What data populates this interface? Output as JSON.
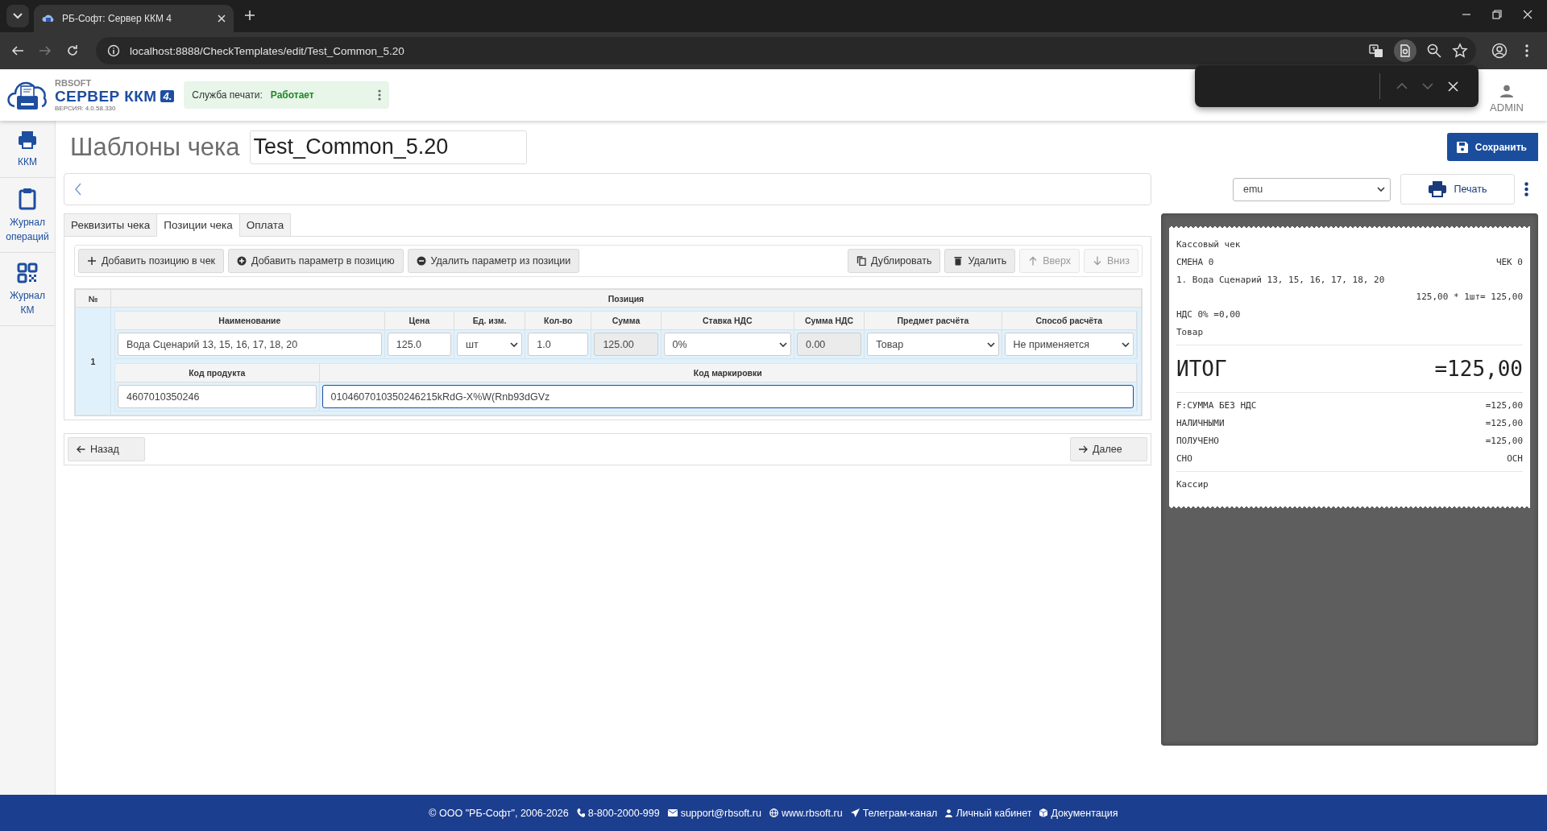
{
  "browser": {
    "tab_title": "РБ-Софт: Сервер ККМ 4",
    "url": "localhost:8888/CheckTemplates/edit/Test_Common_5.20"
  },
  "header": {
    "brand": "RBSOFT",
    "product": "СЕРВЕР ККМ",
    "product_badge": "4.",
    "version": "ВЕРСИЯ: 4.0.58.330",
    "print_service": {
      "label": "Служба печати:",
      "status": "Работает"
    },
    "user": "ADMIN"
  },
  "sidebar": {
    "items": [
      {
        "label": "ККМ"
      },
      {
        "label": "Журнал операций"
      },
      {
        "label": "Журнал КМ"
      }
    ]
  },
  "page": {
    "title": "Шаблоны чека",
    "template_name": "Test_Common_5.20",
    "save_button": "Сохранить",
    "printer": "emu",
    "print_button": "Печать"
  },
  "tabs": [
    {
      "label": "Реквизиты чека",
      "selected": false
    },
    {
      "label": "Позиции чека",
      "selected": true
    },
    {
      "label": "Оплата",
      "selected": false
    }
  ],
  "toolbar": {
    "left": [
      {
        "label": "Добавить позицию в чек",
        "disabled": false
      },
      {
        "label": "Добавить параметр в позицию",
        "disabled": false
      },
      {
        "label": "Удалить параметр из позиции",
        "disabled": false
      }
    ],
    "right": [
      {
        "label": "Дублировать",
        "disabled": false
      },
      {
        "label": "Удалить",
        "disabled": false
      },
      {
        "label": "Вверх",
        "disabled": true
      },
      {
        "label": "Вниз",
        "disabled": true
      }
    ]
  },
  "table": {
    "columns": [
      "№",
      "Позиция"
    ],
    "rows": [
      {
        "number": "1",
        "field_rows": [
          [
            {
              "label": "Наименование",
              "value": "Вода Сценарий 13, 15, 16, 17, 18, 20",
              "kind": "input",
              "focused": false
            },
            {
              "label": "Цена",
              "value": "125.0",
              "kind": "input",
              "focused": false
            },
            {
              "label": "Ед. изм.",
              "value": "шт",
              "kind": "select",
              "focused": false
            },
            {
              "label": "Кол-во",
              "value": "1.0",
              "kind": "input",
              "focused": false
            },
            {
              "label": "Сумма",
              "value": "125.00",
              "kind": "readonly",
              "focused": false
            },
            {
              "label": "Ставка НДС",
              "value": "0%",
              "kind": "select",
              "focused": false
            },
            {
              "label": "Сумма НДС",
              "value": "0.00",
              "kind": "readonly",
              "focused": false
            },
            {
              "label": "Предмет расчёта",
              "value": "Товар",
              "kind": "select",
              "focused": false
            },
            {
              "label": "Способ расчёта",
              "value": "Не применяется",
              "kind": "select",
              "focused": false
            }
          ],
          [
            {
              "label": "Код продукта",
              "value": "4607010350246",
              "kind": "input",
              "focused": false
            },
            {
              "label": "Код маркировки",
              "value": "0104607010350246215kRdG-X%W(Rnb93dGVz",
              "kind": "input",
              "focused": true
            }
          ]
        ]
      }
    ]
  },
  "navigation": {
    "back": "Назад",
    "next": "Далее"
  },
  "receipt": {
    "lines": [
      {
        "kind": "text",
        "left": "Кассовый чек"
      },
      {
        "kind": "pair",
        "left": "СМЕНА 0",
        "right": "ЧЕК 0"
      },
      {
        "kind": "text",
        "left": "1. Вода Сценарий 13, 15, 16, 17, 18, 20"
      },
      {
        "kind": "right",
        "right": "125,00 * 1шт= 125,00"
      },
      {
        "kind": "text",
        "left": "НДС 0% =0,00"
      },
      {
        "kind": "text",
        "left": "Товар"
      },
      {
        "kind": "divider"
      },
      {
        "kind": "total",
        "left": "ИТОГ",
        "right": "=125,00"
      },
      {
        "kind": "divider"
      },
      {
        "kind": "pair",
        "left": "F:СУММА БЕЗ НДС",
        "right": "=125,00"
      },
      {
        "kind": "pair",
        "left": "НАЛИЧНЫМИ",
        "right": "=125,00"
      },
      {
        "kind": "pair",
        "left": "ПОЛУЧЕНО",
        "right": "=125,00"
      },
      {
        "kind": "pair",
        "left": "СНО",
        "right": "ОСН"
      },
      {
        "kind": "divider"
      },
      {
        "kind": "text",
        "left": "Кассир"
      }
    ]
  },
  "footer": {
    "items": [
      "© ООО \"РБ-Софт\", 2006-2026",
      "8-800-2000-999",
      "support@rbsoft.ru",
      "www.rbsoft.ru",
      "Телеграм-канал",
      "Личный кабинет",
      "Документация"
    ]
  }
}
